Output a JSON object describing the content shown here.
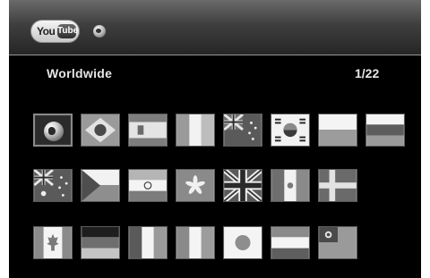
{
  "header": {
    "logo": {
      "you": "You",
      "tube": "Tube"
    },
    "globe_icon": "globe-icon"
  },
  "region": {
    "label": "Worldwide",
    "page": "1/22"
  },
  "flags": [
    {
      "name": "worldwide-globe",
      "selected": true
    },
    {
      "name": "brazil"
    },
    {
      "name": "spain"
    },
    {
      "name": "ireland"
    },
    {
      "name": "new-zealand"
    },
    {
      "name": "south-korea"
    },
    {
      "name": "poland"
    },
    {
      "name": "russia"
    },
    {
      "name": "australia"
    },
    {
      "name": "czech-republic"
    },
    {
      "name": "india"
    },
    {
      "name": "hong-kong"
    },
    {
      "name": "united-kingdom"
    },
    {
      "name": "mexico"
    },
    {
      "name": "sweden"
    },
    {
      "name": "canada"
    },
    {
      "name": "germany"
    },
    {
      "name": "france"
    },
    {
      "name": "italy"
    },
    {
      "name": "japan"
    },
    {
      "name": "netherlands"
    },
    {
      "name": "taiwan"
    }
  ]
}
